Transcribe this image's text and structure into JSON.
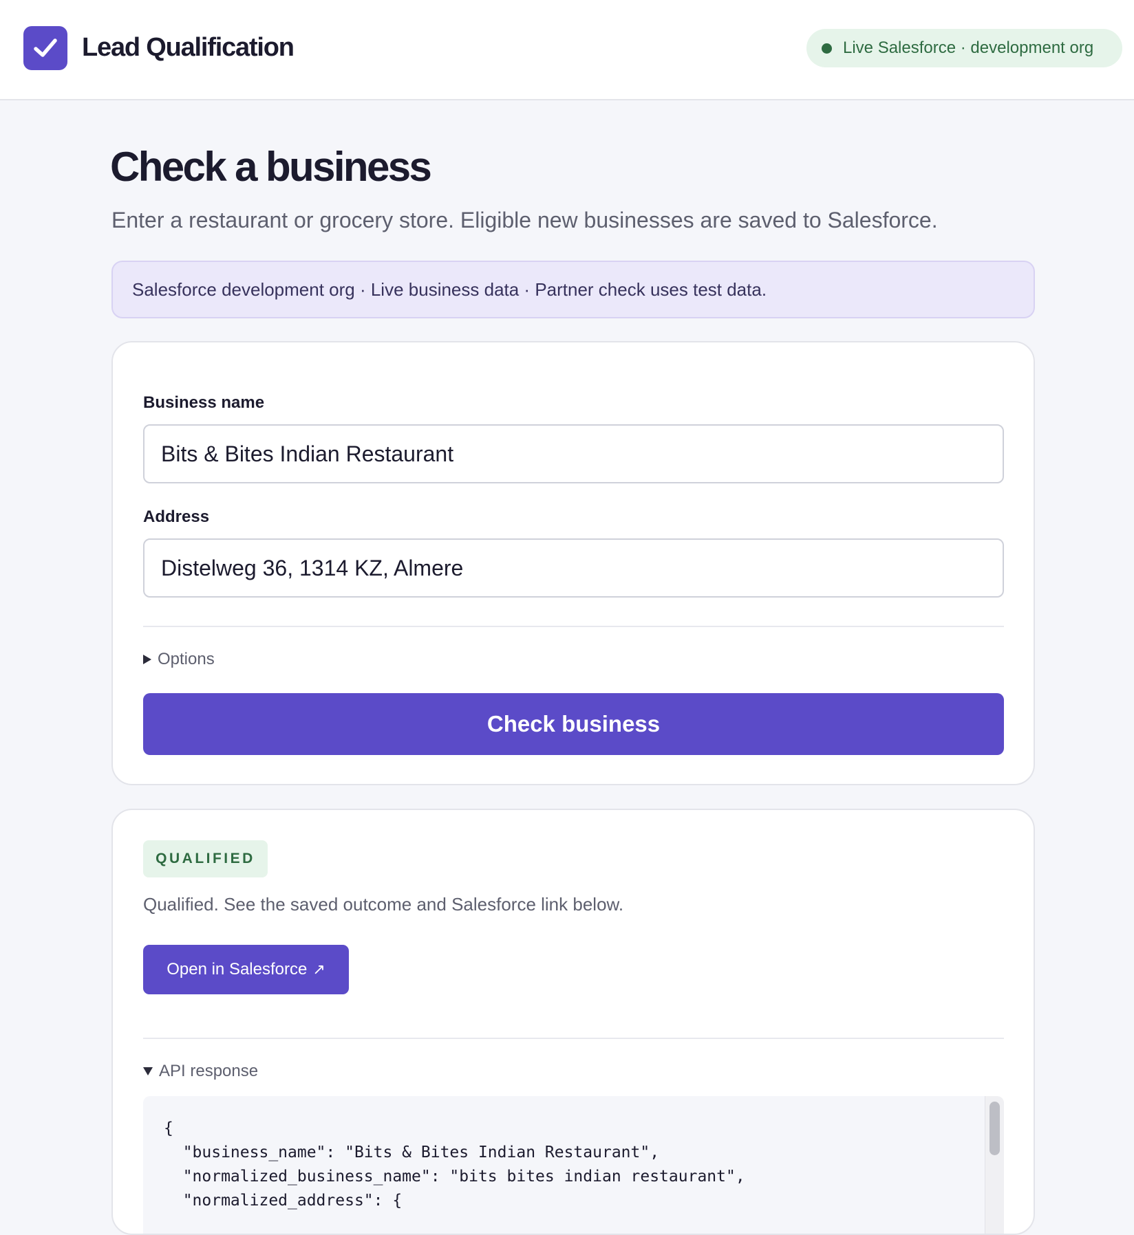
{
  "header": {
    "app_title": "Lead Qualification",
    "status": "Live Salesforce · development org",
    "brand_color": "#5b4bc8",
    "status_color": "#2e6b41"
  },
  "page": {
    "title": "Check a business",
    "subtitle": "Enter a restaurant or grocery store. Eligible new businesses are saved to Salesforce.",
    "banner": "Salesforce development org · Live business data · Partner check uses test data."
  },
  "form": {
    "business_name_label": "Business name",
    "business_name_value": "Bits & Bites Indian Restaurant",
    "address_label": "Address",
    "address_value": "Distelweg 36, 1314 KZ, Almere",
    "options_label": "Options",
    "submit_label": "Check business"
  },
  "result": {
    "badge": "QUALIFIED",
    "message": "Qualified. See the saved outcome and Salesforce link below.",
    "open_button": "Open in Salesforce",
    "open_icon": "↗",
    "api_toggle_label": "API response",
    "api_response": "{\n  \"business_name\": \"Bits & Bites Indian Restaurant\",\n  \"normalized_business_name\": \"bits bites indian restaurant\",\n  \"normalized_address\": {"
  }
}
